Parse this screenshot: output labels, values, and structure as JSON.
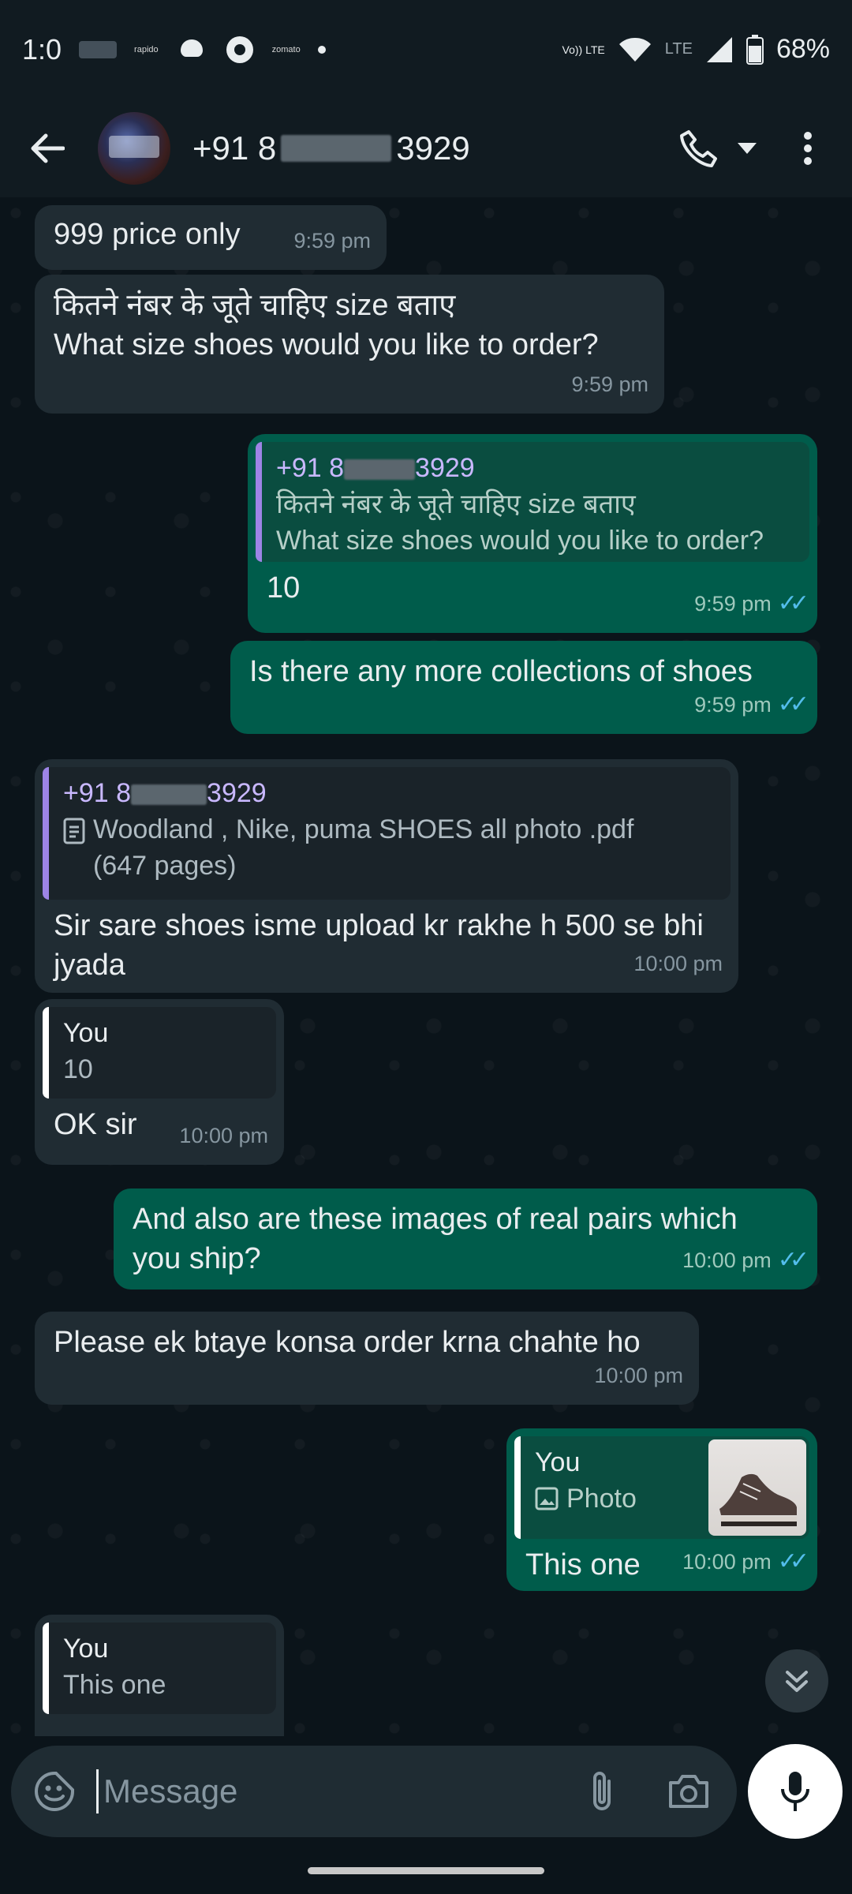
{
  "status_bar": {
    "time": "1:0",
    "notif_1": "rapido",
    "notif_2": "zomato",
    "network_1": "Vo)) LTE",
    "network_2": "LTE",
    "battery": "68%"
  },
  "header": {
    "contact_prefix": "+91 8",
    "contact_suffix": "3929",
    "icons": [
      "back-arrow-icon",
      "phone-icon",
      "dropdown-icon",
      "more-vert-icon"
    ]
  },
  "messages": [
    {
      "dir": "in",
      "text": "999 price only",
      "time": "9:59 pm"
    },
    {
      "dir": "in",
      "text": "कितने नंबर के जूते चाहिए size बताए\nWhat size shoes would you like to order?",
      "time": "9:59 pm"
    },
    {
      "dir": "out",
      "quote_name": "+91 8 3929",
      "quote_name_prefix": "+91 8",
      "quote_name_suffix": "3929",
      "quote_text": "कितने नंबर के जूते चाहिए size बताए\nWhat size shoes would you like to order?",
      "text": "10",
      "time": "9:59 pm"
    },
    {
      "dir": "out",
      "text": "Is there any more collections of shoes",
      "time": "9:59 pm"
    },
    {
      "dir": "in",
      "quote_name_prefix": "+91 8",
      "quote_name_suffix": "3929",
      "quote_text": "Woodland , Nike, puma SHOES all photo .pdf\n(647 pages)",
      "text": "Sir sare shoes isme upload kr rakhe h 500 se bhi jyada",
      "time": "10:00 pm"
    },
    {
      "dir": "in",
      "quote_name": "You",
      "quote_text": "10",
      "text": "OK sir",
      "time": "10:00 pm"
    },
    {
      "dir": "out",
      "text": "And also are these images of real pairs which you ship?",
      "time": "10:00 pm"
    },
    {
      "dir": "in",
      "text": "Please ek btaye konsa order krna chahte ho",
      "time": "10:00 pm"
    },
    {
      "dir": "out",
      "quote_name": "You",
      "quote_text": "Photo",
      "text": "This one",
      "time": "10:00 pm"
    },
    {
      "dir": "in",
      "quote_name": "You",
      "quote_text": "This one",
      "text": "",
      "time": ""
    }
  ],
  "input": {
    "placeholder": "Message",
    "icons": [
      "sticker-icon",
      "attach-icon",
      "camera-icon",
      "mic-icon"
    ]
  },
  "colors": {
    "background": "#0b141a",
    "incoming": "#202c33",
    "outgoing": "#005c4b",
    "read_ticks": "#53bdeb"
  }
}
